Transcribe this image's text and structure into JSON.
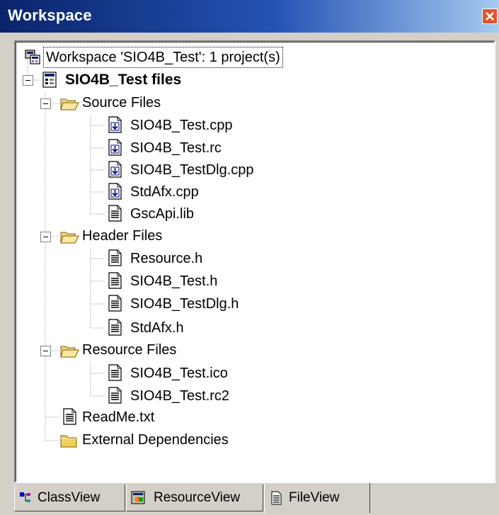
{
  "window": {
    "title": "Workspace",
    "accent": "#0a246a"
  },
  "tree": {
    "workspace_label": "Workspace 'SIO4B_Test': 1 project(s)",
    "project_label": "SIO4B_Test files",
    "groups": [
      {
        "label": "Source Files",
        "files": [
          {
            "label": "SIO4B_Test.cpp",
            "icon": "source-file-icon"
          },
          {
            "label": "SIO4B_Test.rc",
            "icon": "source-file-icon"
          },
          {
            "label": "SIO4B_TestDlg.cpp",
            "icon": "source-file-icon"
          },
          {
            "label": "StdAfx.cpp",
            "icon": "source-file-icon"
          },
          {
            "label": "GscApi.lib",
            "icon": "text-file-icon"
          }
        ]
      },
      {
        "label": "Header Files",
        "files": [
          {
            "label": "Resource.h",
            "icon": "text-file-icon"
          },
          {
            "label": "SIO4B_Test.h",
            "icon": "text-file-icon"
          },
          {
            "label": "SIO4B_TestDlg.h",
            "icon": "text-file-icon"
          },
          {
            "label": "StdAfx.h",
            "icon": "text-file-icon"
          }
        ]
      },
      {
        "label": "Resource Files",
        "files": [
          {
            "label": "SIO4B_Test.ico",
            "icon": "text-file-icon"
          },
          {
            "label": "SIO4B_Test.rc2",
            "icon": "text-file-icon"
          }
        ]
      }
    ],
    "readme_label": "ReadMe.txt",
    "external_label": "External Dependencies"
  },
  "tabs": [
    {
      "label": "ClassView",
      "active": false
    },
    {
      "label": "ResourceView",
      "active": false
    },
    {
      "label": "FileView",
      "active": true
    }
  ]
}
